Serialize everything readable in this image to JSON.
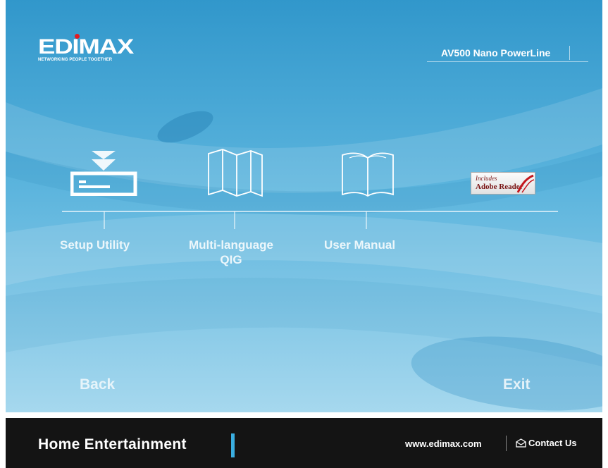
{
  "header": {
    "logo_text": "EDIMAX",
    "logo_tagline": "NETWORKING PEOPLE TOGETHER",
    "product_name": "AV500 Nano PowerLine"
  },
  "menu": {
    "items": [
      {
        "label": "Setup Utility",
        "icon": "install-drive-icon"
      },
      {
        "label": "Multi-language\nQIG",
        "icon": "folded-map-icon"
      },
      {
        "label": "User Manual",
        "icon": "open-book-icon"
      }
    ],
    "adobe_badge": {
      "line1": "Includes",
      "line2": "Adobe Reader"
    }
  },
  "nav": {
    "back_label": "Back",
    "exit_label": "Exit"
  },
  "footer": {
    "title": "Home  Entertainment",
    "url": "www.edimax.com",
    "contact_label": "Contact Us",
    "contact_icon": "envelope-icon"
  },
  "colors": {
    "bg_top": "#3a9fd0",
    "bg_bottom": "#a9d9ee",
    "footer": "#141414",
    "accent": "#3aaee0",
    "logo_dot": "#e31b23"
  }
}
